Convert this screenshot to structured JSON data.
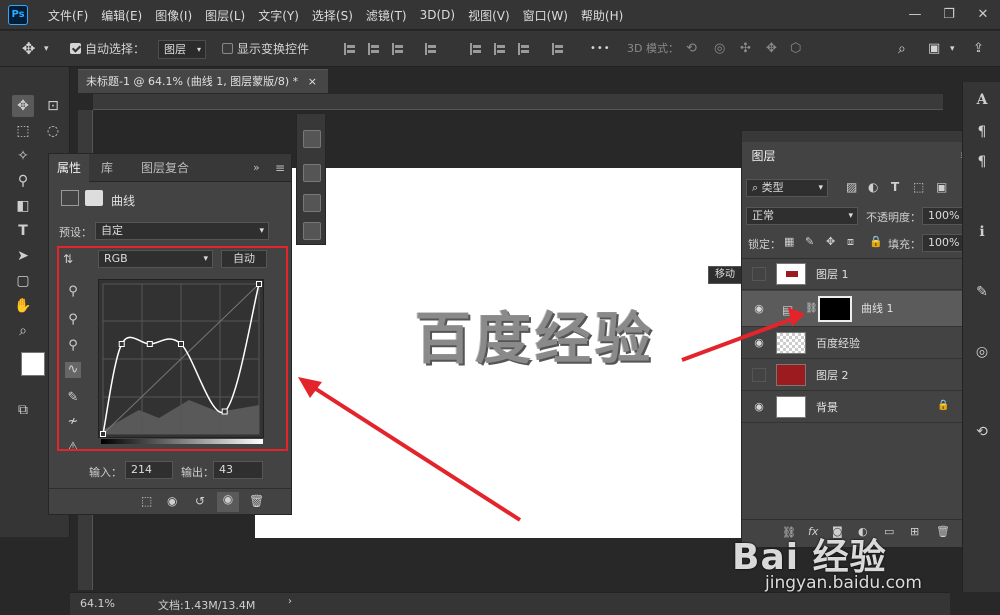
{
  "app": {
    "logo": "Ps"
  },
  "menu": [
    "文件(F)",
    "编辑(E)",
    "图像(I)",
    "图层(L)",
    "文字(Y)",
    "选择(S)",
    "滤镜(T)",
    "3D(D)",
    "视图(V)",
    "窗口(W)",
    "帮助(H)"
  ],
  "window_controls": {
    "minimize": "—",
    "restore": "❐",
    "close": "✕"
  },
  "options": {
    "move_glyph": "✥",
    "auto_select_label": "自动选择：",
    "auto_select_target": "图层",
    "show_transform_label": "显示变换控件",
    "mode_3d_label": "3D 模式：",
    "more_glyph": "•••"
  },
  "document": {
    "tab_title": "未标题-1 @ 64.1% (曲线 1, 图层蒙版/8) *",
    "tab_close": "×",
    "canvas_text": "百度经验",
    "tooltip": "移动",
    "zoom": "64.1%",
    "doc_info": "文档:1.43M/13.4M"
  },
  "properties": {
    "tabs": [
      "属性",
      "库",
      "图层复合"
    ],
    "adjustment_name": "曲线",
    "preset_label": "预设：",
    "preset_value": "自定",
    "channel": "RGB",
    "auto_button": "自动",
    "input_label": "输入：",
    "input_value": "214",
    "output_label": "输出：",
    "output_value": "43",
    "curve_points": [
      [
        0,
        0
      ],
      [
        0.12,
        0.6
      ],
      [
        0.3,
        0.6
      ],
      [
        0.5,
        0.6
      ],
      [
        0.78,
        0.15
      ],
      [
        1,
        1
      ]
    ]
  },
  "layers": {
    "tab": "图层",
    "filter_kind": "类型",
    "blend_mode": "正常",
    "opacity_label": "不透明度：",
    "opacity_value": "100%",
    "lock_label": "锁定：",
    "fill_label": "填充：",
    "fill_value": "100%",
    "items": [
      {
        "name": "图层 1",
        "visible": false
      },
      {
        "name": "曲线 1",
        "visible": true,
        "selected": true
      },
      {
        "name": "百度经验",
        "visible": true
      },
      {
        "name": "图层 2",
        "visible": false
      },
      {
        "name": "背景",
        "visible": true,
        "locked": true
      }
    ],
    "fx_label": "fx"
  },
  "watermark": {
    "logo": "Bai 经验",
    "url": "jingyan.baidu.com"
  },
  "colors": {
    "highlight": "#e3242b",
    "canvas": "#ffffff",
    "layer2_fill": "#9b1b1f",
    "panel_bg": "#434343"
  }
}
